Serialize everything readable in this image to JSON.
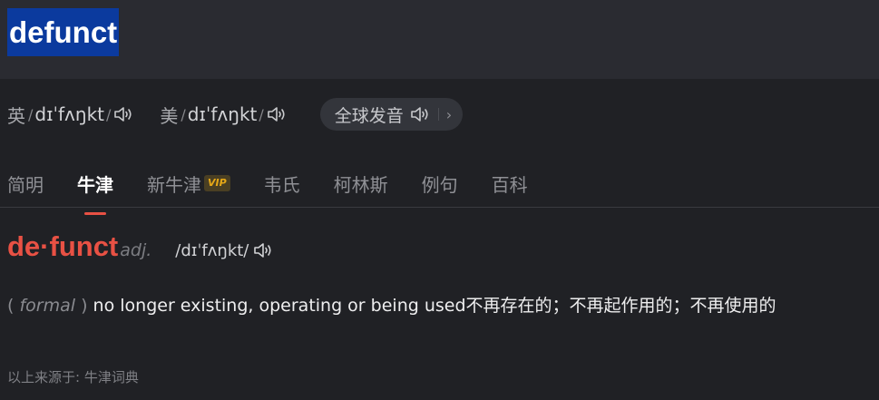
{
  "header": {
    "word": "defunct"
  },
  "pronunciation": {
    "uk": {
      "region": "英",
      "ipa": "dɪˈfʌŋkt"
    },
    "us": {
      "region": "美",
      "ipa": "dɪˈfʌŋkt"
    },
    "global_label": "全球发音",
    "chevron": "›"
  },
  "tabs": [
    {
      "label": "简明",
      "active": false
    },
    {
      "label": "牛津",
      "active": true
    },
    {
      "label": "新牛津",
      "badge": "VIP",
      "active": false
    },
    {
      "label": "韦氏",
      "active": false
    },
    {
      "label": "柯林斯",
      "active": false
    },
    {
      "label": "例句",
      "active": false
    },
    {
      "label": "百科",
      "active": false
    }
  ],
  "entry": {
    "headword": "de·funct",
    "pos": "adj.",
    "ipa": "/dɪˈfʌŋkt/",
    "definition": {
      "open": "(",
      "register": "formal",
      "close": ")",
      "text": "no longer existing, operating or being used不再存在的；不再起作用的；不再使用的"
    }
  },
  "source": "以上来源于: 牛津词典",
  "colors": {
    "accent": "#e85144",
    "highlight": "#0b3a9e",
    "background": "#202125",
    "vip": "#e6a817"
  },
  "icons": {
    "speaker": "speaker-icon",
    "chevron": "chevron-right-icon"
  }
}
